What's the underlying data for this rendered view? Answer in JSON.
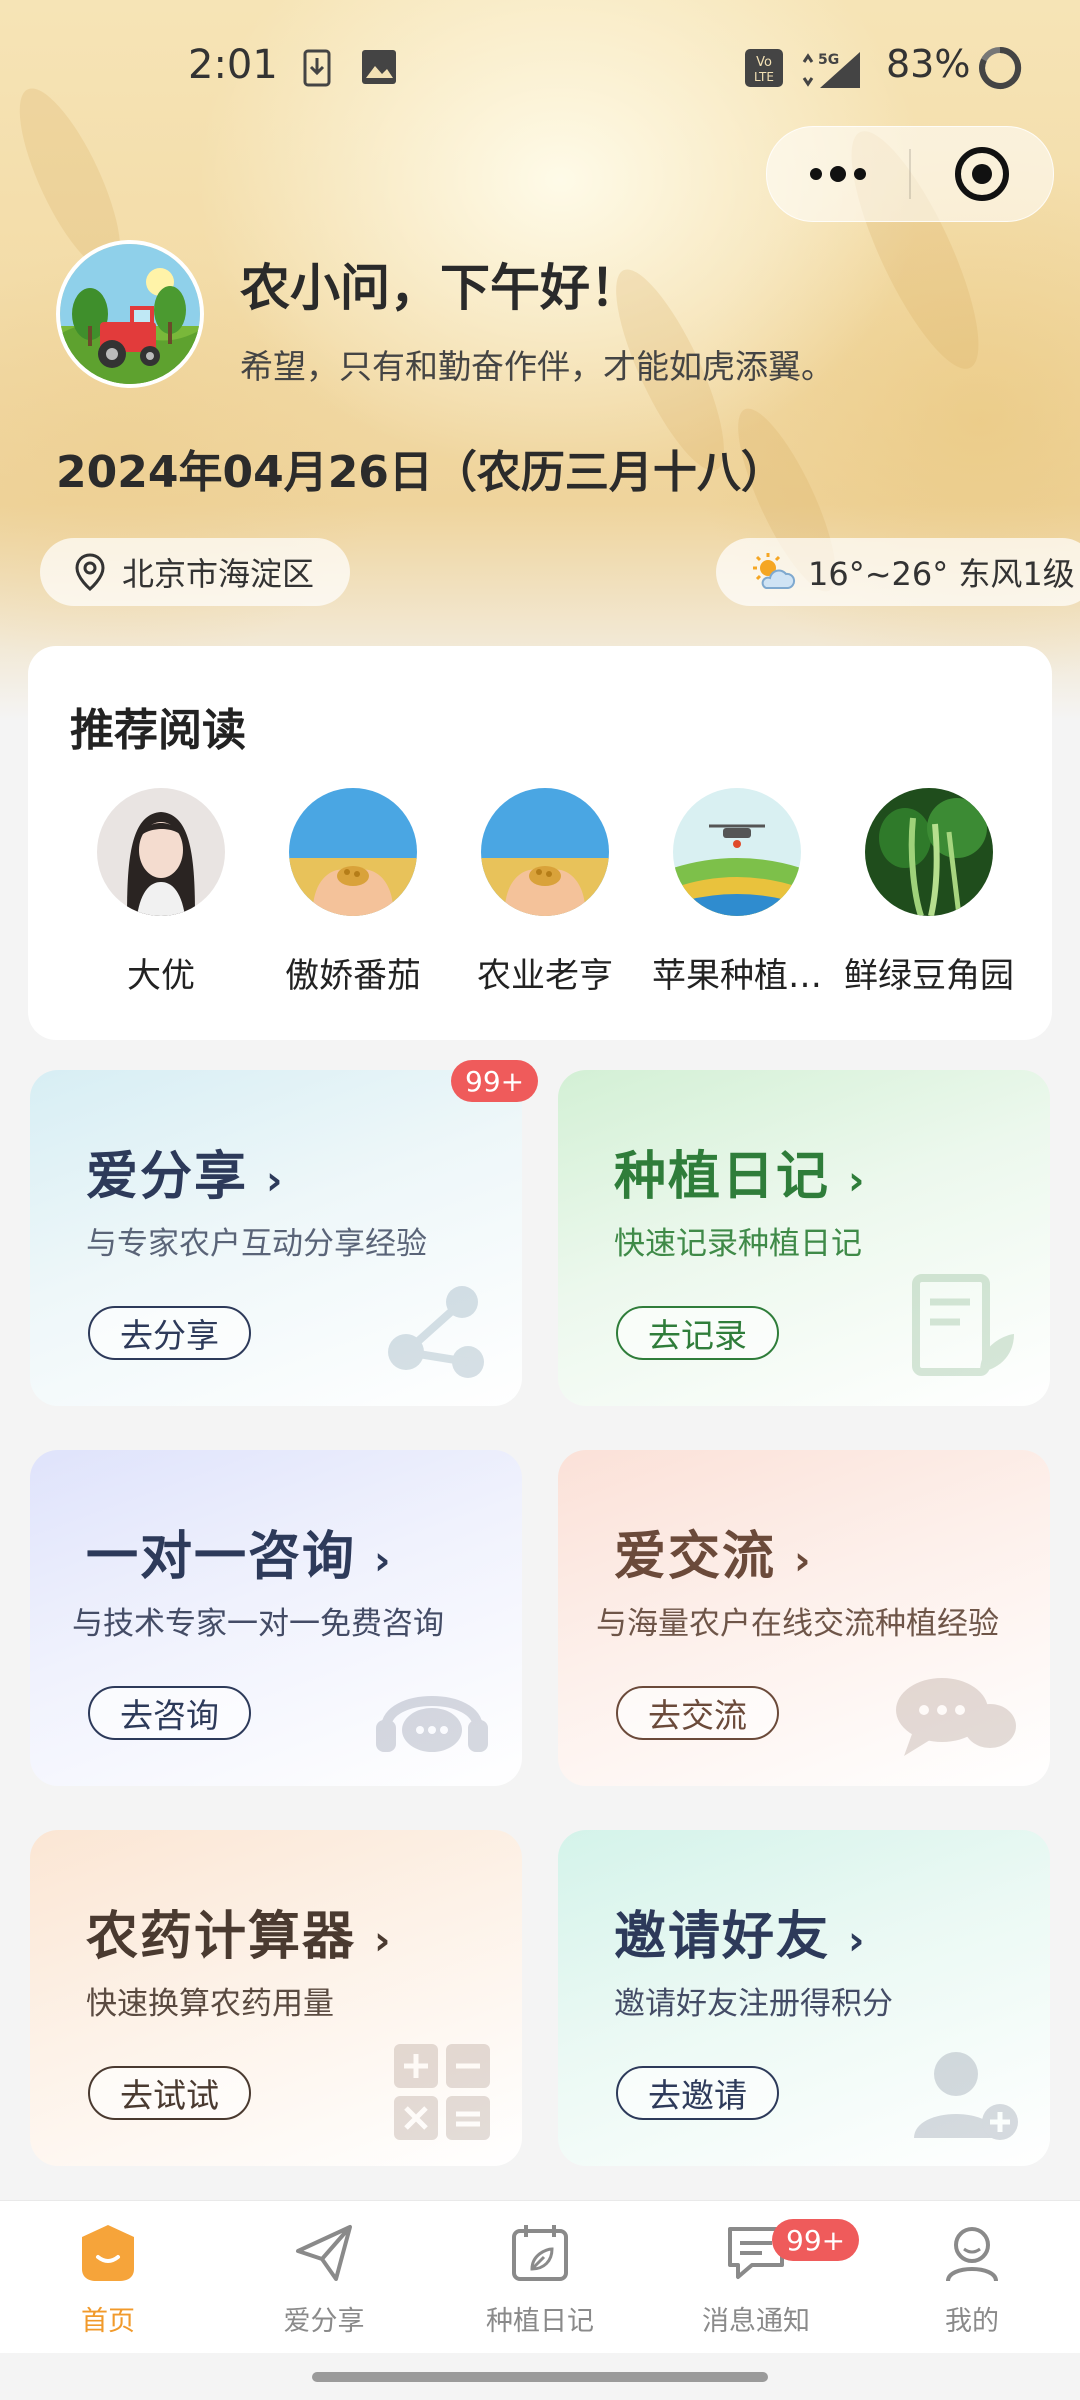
{
  "status_bar": {
    "time": "2:01",
    "battery": "83%",
    "network": "5G"
  },
  "header": {
    "greeting": "农小问，下午好！",
    "motto": "希望，只有和勤奋作伴，才能如虎添翼。",
    "date": "2024年04月26日（农历三月十八）",
    "location": "北京市海淀区",
    "weather": "16°~26° 东风1级"
  },
  "reading": {
    "title": "推荐阅读",
    "items": [
      {
        "name": "大优"
      },
      {
        "name": "傲娇番茄"
      },
      {
        "name": "农业老亨"
      },
      {
        "name": "苹果种植…"
      },
      {
        "name": "鲜绿豆角园"
      }
    ]
  },
  "cards": [
    {
      "title": "爱分享",
      "subtitle": "与专家农户互动分享经验",
      "button": "去分享",
      "badge": "99+"
    },
    {
      "title": "种植日记",
      "subtitle": "快速记录种植日记",
      "button": "去记录"
    },
    {
      "title": "一对一咨询",
      "subtitle": "与技术专家一对一免费咨询",
      "button": "去咨询"
    },
    {
      "title": "爱交流",
      "subtitle": "与海量农户在线交流种植经验",
      "button": "去交流"
    },
    {
      "title": "农药计算器",
      "subtitle": "快速换算农药用量",
      "button": "去试试"
    },
    {
      "title": "邀请好友",
      "subtitle": "邀请好友注册得积分",
      "button": "去邀请"
    }
  ],
  "tabbar": {
    "items": [
      {
        "label": "首页"
      },
      {
        "label": "爱分享"
      },
      {
        "label": "种植日记"
      },
      {
        "label": "消息通知",
        "badge": "99+"
      },
      {
        "label": "我的"
      }
    ]
  },
  "colors": {
    "accent": "#f19a2b",
    "badge": "#ef5b5b",
    "green": "#2f7d3a",
    "navy": "#2d3a5a",
    "brown": "#6b4a3a"
  }
}
